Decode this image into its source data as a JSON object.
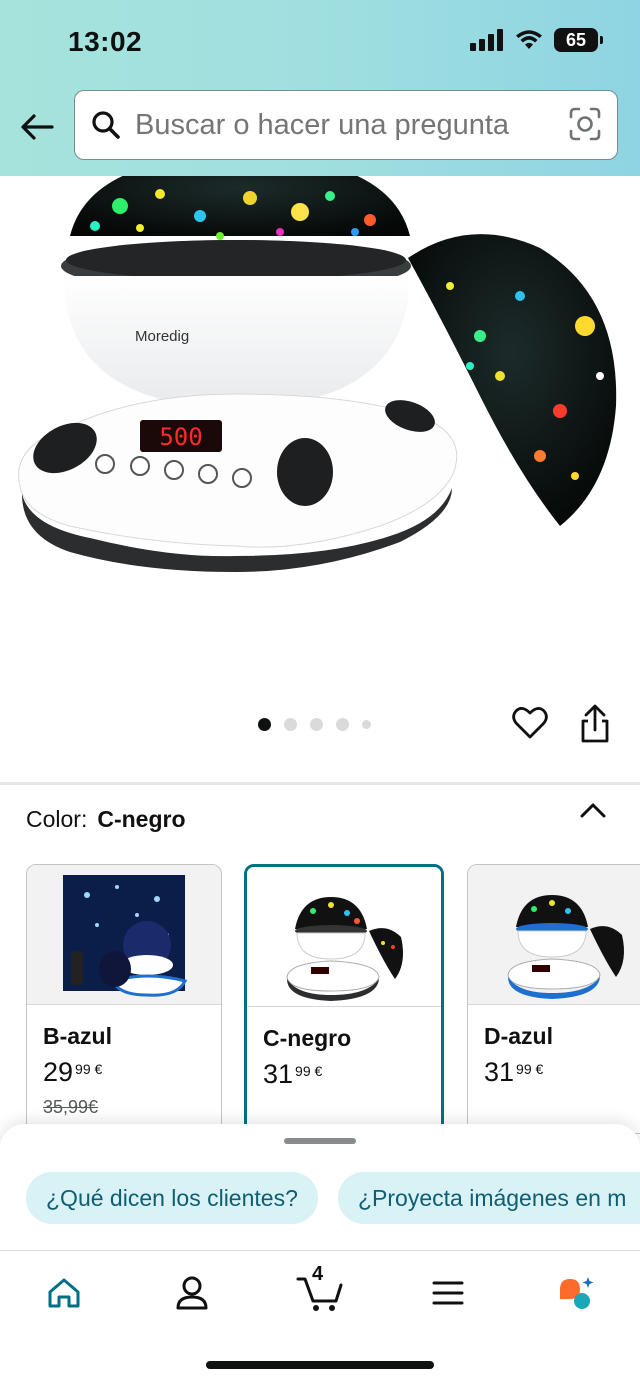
{
  "status_bar": {
    "time": "13:02",
    "battery": "65"
  },
  "search": {
    "placeholder": "Buscar o hacer una pregunta"
  },
  "product": {
    "brand_text": "Moredig",
    "display_readout": "500",
    "image_count": 5,
    "active_image_index": 0
  },
  "color_selector": {
    "label": "Color:",
    "selected_value": "C-negro",
    "options": [
      {
        "name": "B-azul",
        "price_whole": "29",
        "price_fraction": "99",
        "currency": "€",
        "old_price": "35,99€",
        "accent": "#1f6fd0"
      },
      {
        "name": "C-negro",
        "price_whole": "31",
        "price_fraction": "99",
        "currency": "€",
        "old_price": "",
        "accent": "#333333"
      },
      {
        "name": "D-azul",
        "price_whole": "31",
        "price_fraction": "99",
        "currency": "€",
        "old_price": "",
        "accent": "#1f6fd0"
      }
    ]
  },
  "suggestions": {
    "chips": [
      "¿Qué dicen los clientes?",
      "¿Proyecta imágenes en m"
    ]
  },
  "bottom_nav": {
    "cart_count": "4",
    "items": [
      "home-icon",
      "account-icon",
      "cart-icon",
      "menu-icon",
      "rufus-icon"
    ]
  },
  "colors": {
    "teal_accent": "#007185",
    "chip_bg": "#d8f2f5",
    "chip_text": "#0f5e73",
    "header_gradient": "#9fdfe0"
  }
}
